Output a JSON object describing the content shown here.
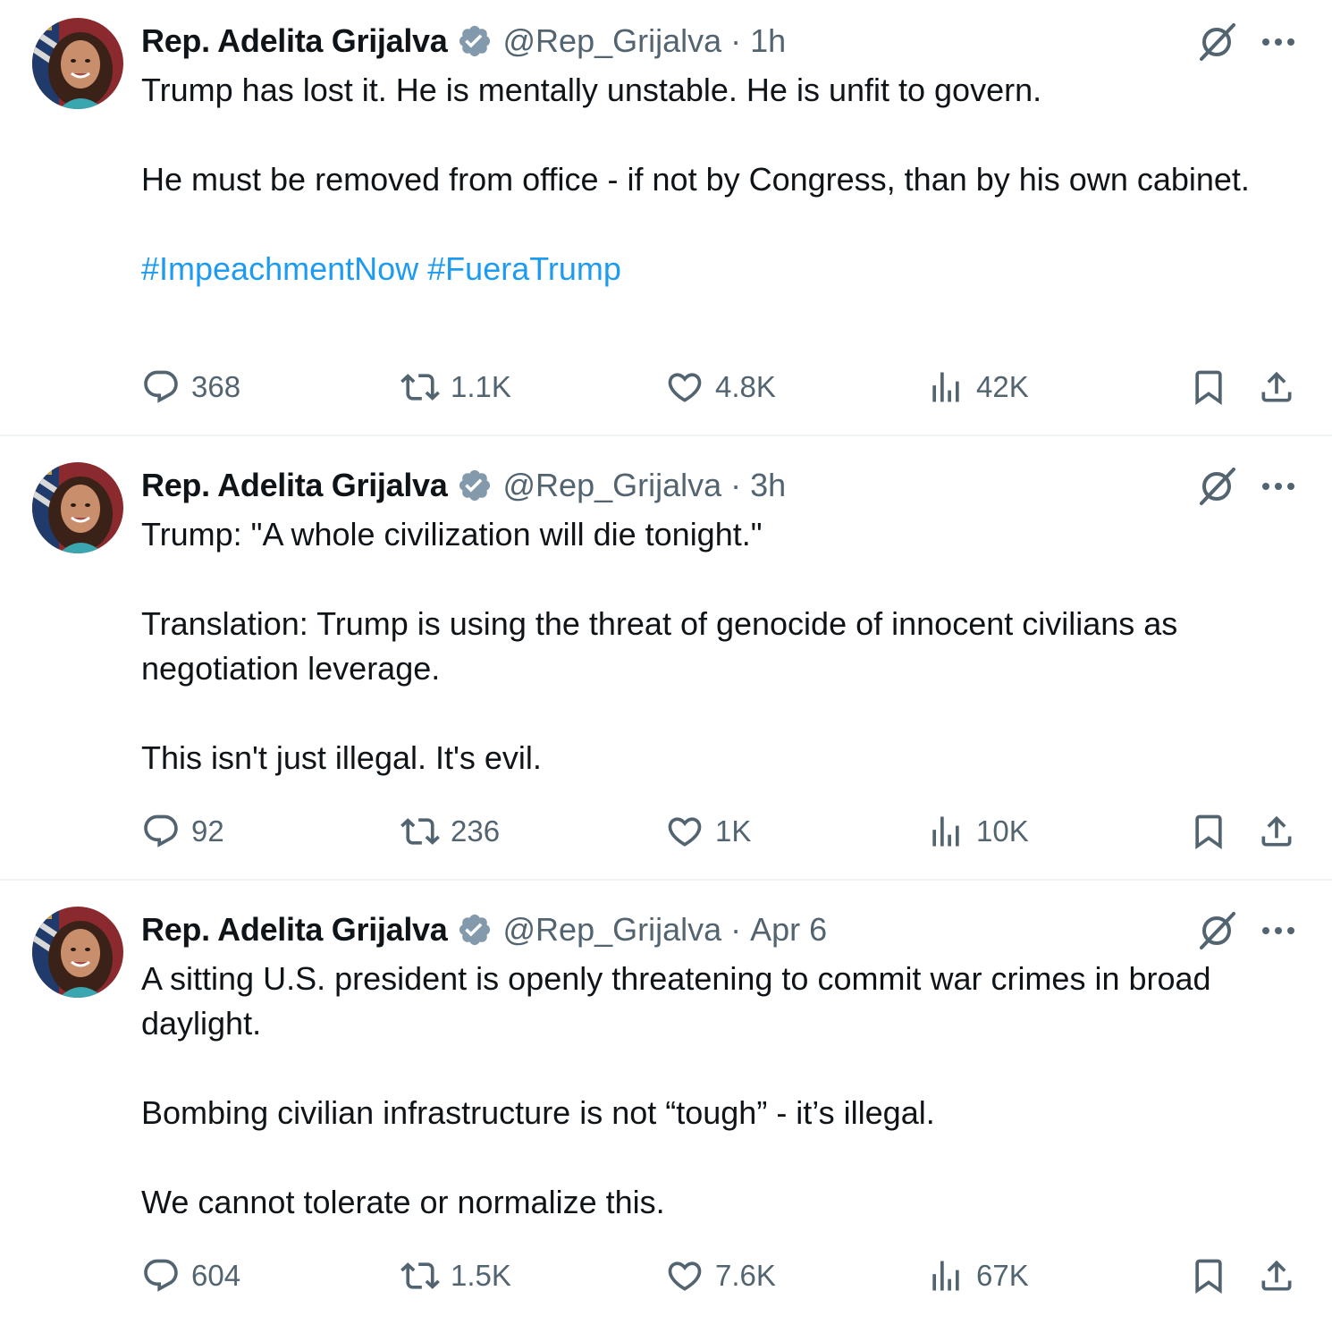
{
  "author": {
    "name": "Rep. Adelita Grijalva",
    "handle": "@Rep_Grijalva",
    "verified_badge_icon": "verified-badge-icon",
    "badge_color": "#829aab"
  },
  "colors": {
    "text": "#0f1419",
    "secondary": "#536471",
    "link": "#1d9bf0",
    "divider": "#eff3f4"
  },
  "tweets": [
    {
      "time": "1h",
      "paragraphs": [
        "Trump has lost it. He is mentally unstable. He is unfit to govern.",
        "He must be removed from office - if not by Congress, than by his own cabinet."
      ],
      "hashtags": [
        "#ImpeachmentNow",
        "#FueraTrump"
      ],
      "stats": {
        "replies": "368",
        "reposts": "1.1K",
        "likes": "4.8K",
        "views": "42K"
      }
    },
    {
      "time": "3h",
      "paragraphs": [
        "Trump: \"A whole civilization will die tonight.\"",
        "Translation: Trump is using the threat of genocide of innocent civilians as negotiation leverage.",
        "This isn't just illegal. It's evil."
      ],
      "hashtags": [],
      "stats": {
        "replies": "92",
        "reposts": "236",
        "likes": "1K",
        "views": "10K"
      }
    },
    {
      "time": "Apr 6",
      "paragraphs": [
        "A sitting U.S. president is openly threatening to commit war crimes in broad daylight.",
        "Bombing civilian infrastructure is not “tough” - it’s illegal.",
        "We cannot tolerate or normalize this."
      ],
      "hashtags": [],
      "stats": {
        "replies": "604",
        "reposts": "1.5K",
        "likes": "7.6K",
        "views": "67K"
      }
    }
  ],
  "separator": "·",
  "icons": [
    "avatar",
    "verified-badge-icon",
    "grok-icon",
    "more-icon",
    "reply-icon",
    "repost-icon",
    "like-icon",
    "views-icon",
    "bookmark-icon",
    "share-icon"
  ]
}
